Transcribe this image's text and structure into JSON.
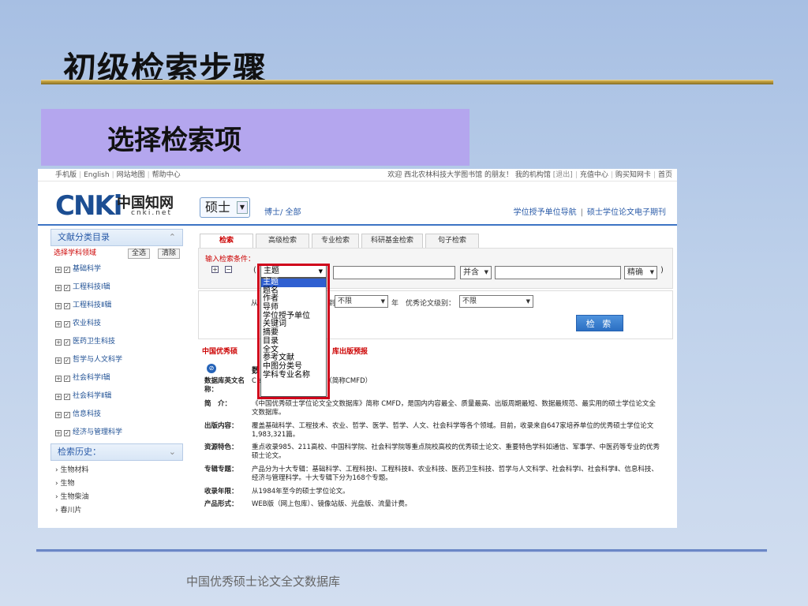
{
  "slide": {
    "title": "初级检索步骤",
    "subtitle": "选择检索项",
    "footer": "中国优秀硕士论文全文数据库"
  },
  "topbar": {
    "left_links": [
      "手机版",
      "English",
      "网站地图",
      "帮助中心"
    ],
    "welcome": "欢迎 西北农林科技大学图书馆 的朋友！",
    "right_links": [
      "我的机构馆",
      "[退出]",
      "充值中心",
      "购买知网卡",
      "首页"
    ]
  },
  "header": {
    "logo_text": "CNKi",
    "logo_cn": "中国知网",
    "logo_sub": "cnki.net",
    "database_select": "硕士",
    "breadcrumb": "博士/ 全部",
    "nav_links": [
      "学位授予单位导航",
      "硕士学位论文电子期刊"
    ]
  },
  "sidebar": {
    "category_title": "文献分类目录",
    "select_label": "选择学科领域",
    "select_all": "全选",
    "clear": "清除",
    "categories": [
      "基础科学",
      "工程科技Ⅰ辑",
      "工程科技Ⅱ辑",
      "农业科技",
      "医药卫生科技",
      "哲学与人文科学",
      "社会科学Ⅰ辑",
      "社会科学Ⅱ辑",
      "信息科技",
      "经济与管理科学"
    ],
    "history_title": "检索历史：",
    "history": [
      "生物材料",
      "生物",
      "生物柴油",
      "春川片"
    ]
  },
  "tabs": [
    "检索",
    "高级检索",
    "专业检索",
    "科研基金检索",
    "句子检索"
  ],
  "search": {
    "input_label": "输入检索条件：",
    "field": "主题",
    "logic": "并含",
    "match": "精确",
    "from_label": "从",
    "to_label": "到",
    "year_from": "不限",
    "year_label": "年",
    "level_label": "优秀论文级别：",
    "level": "不限",
    "button": "检 索"
  },
  "dropdown": {
    "options": [
      "主题",
      "题名",
      "作者",
      "导师",
      "学位授予单位",
      "关键词",
      "摘要",
      "目录",
      "全文",
      "参考文献",
      "中图分类号",
      "学科专业名称"
    ],
    "selected_index": 0
  },
  "info": {
    "promo_left": "中国优秀硕",
    "promo_right": "库出版预报",
    "db_name_cn": "数",
    "rows": [
      {
        "k": "数据库英文名称：",
        "v": "C                                s Full-text Database（简称CMFD）"
      },
      {
        "k": "简　介：",
        "v": "《中国优秀硕士学位论文全文数据库》简称 CMFD，是国内内容最全、质量最高、出版周期最短、数据最规范、最实用的硕士学位论文全文数据库。"
      },
      {
        "k": "出版内容：",
        "v": "覆盖基础科学、工程技术、农业、哲学、医学、哲学、人文、社会科学等各个领域。目前，收录来自647家培养单位的优秀硕士学位论文1,983,321篇。"
      },
      {
        "k": "资源特色：",
        "v": "重点收录985、211高校、中国科学院、社会科学院等重点院校高校的优秀硕士论文、重要特色学科如通信、军事学、中医药等专业的优秀硕士论文。"
      },
      {
        "k": "专辑专题：",
        "v": "产品分为十大专辑：基础科学、工程科技Ⅰ、工程科技Ⅱ、农业科技、医药卫生科技、哲学与人文科学、社会科学Ⅰ、社会科学Ⅱ、信息科技、经济与管理科学。十大专辑下分为168个专题。"
      },
      {
        "k": "收录年限：",
        "v": "从1984年至今的硕士学位论文。"
      },
      {
        "k": "产品形式：",
        "v": "WEB版（网上包库）、镜像站版、光盘版、流量计费。"
      }
    ]
  }
}
